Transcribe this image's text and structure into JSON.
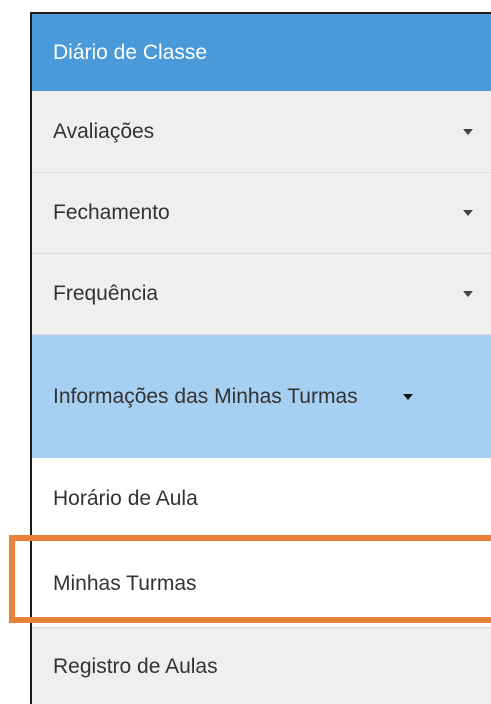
{
  "menu": {
    "header": "Diário de Classe",
    "items": [
      {
        "label": "Avaliações",
        "icon": "caret-down-icon"
      },
      {
        "label": "Fechamento",
        "icon": "caret-down-icon"
      },
      {
        "label": "Frequência",
        "icon": "caret-down-icon"
      },
      {
        "label": "Informações das Minhas Turmas",
        "icon": "caret-down-icon",
        "expanded": true
      }
    ],
    "subitems": [
      {
        "label": "Horário de Aula"
      },
      {
        "label": "Minhas Turmas",
        "highlighted": true
      },
      {
        "label": "Registro de Aulas"
      }
    ]
  },
  "colors": {
    "header": "#4a99d8",
    "active": "#a7cff2",
    "item_bg": "#efefef",
    "highlight": "#e8823a"
  }
}
